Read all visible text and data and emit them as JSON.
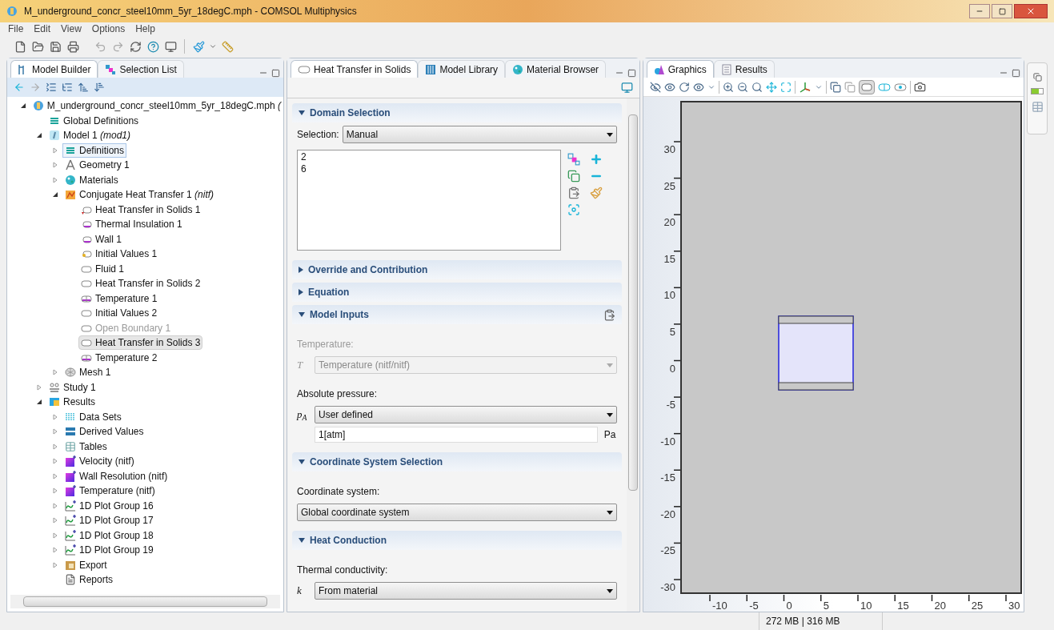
{
  "window": {
    "title": "M_underground_concr_steel10mm_5yr_18degC.mph - COMSOL Multiphysics"
  },
  "menu": [
    "File",
    "Edit",
    "View",
    "Options",
    "Help"
  ],
  "model_tree": {
    "tabs": [
      {
        "label": "Model Builder",
        "kind": "builder",
        "selected": true
      },
      {
        "label": "Selection List",
        "kind": "selection",
        "selected": false
      }
    ],
    "items": [
      {
        "label": "M_underground_concr_steel10mm_5yr_18degC.mph *(*",
        "kind": "file",
        "expanded": true,
        "selected": false,
        "focused": false,
        "disabled": false,
        "children": [
          {
            "label": "Global Definitions",
            "kind": "definitions",
            "selected": false,
            "focused": false,
            "disabled": false
          },
          {
            "label": "Model 1 *(mod1)*",
            "kind": "model",
            "expanded": true,
            "selected": false,
            "focused": false,
            "disabled": false,
            "children": [
              {
                "label": "Definitions",
                "kind": "definitions",
                "expanded": false,
                "selected": false,
                "focused": true,
                "disabled": false
              },
              {
                "label": "Geometry 1",
                "kind": "geometry",
                "expanded": false,
                "selected": false,
                "focused": false,
                "disabled": false
              },
              {
                "label": "Materials",
                "kind": "materials",
                "expanded": false,
                "selected": false,
                "focused": false,
                "disabled": false
              },
              {
                "label": "Conjugate Heat Transfer 1 *(nitf)*",
                "kind": "physics",
                "expanded": true,
                "selected": false,
                "focused": false,
                "disabled": false,
                "children": [
                  {
                    "label": "Heat Transfer in Solids 1",
                    "kind": "default-domain",
                    "selected": false,
                    "focused": false,
                    "disabled": false
                  },
                  {
                    "label": "Thermal Insulation 1",
                    "kind": "default-boundary",
                    "selected": false,
                    "focused": false,
                    "disabled": false
                  },
                  {
                    "label": "Wall 1",
                    "kind": "default-boundary",
                    "selected": false,
                    "focused": false,
                    "disabled": false
                  },
                  {
                    "label": "Initial Values 1",
                    "kind": "default-init",
                    "selected": false,
                    "focused": false,
                    "disabled": false
                  },
                  {
                    "label": "Fluid 1",
                    "kind": "domain",
                    "selected": false,
                    "focused": false,
                    "disabled": false
                  },
                  {
                    "label": "Heat Transfer in Solids 2",
                    "kind": "domain",
                    "selected": false,
                    "focused": false,
                    "disabled": false
                  },
                  {
                    "label": "Temperature 1",
                    "kind": "boundary",
                    "selected": false,
                    "focused": false,
                    "disabled": false
                  },
                  {
                    "label": "Initial Values 2",
                    "kind": "domain",
                    "selected": false,
                    "focused": false,
                    "disabled": false
                  },
                  {
                    "label": "Open Boundary 1",
                    "kind": "domain",
                    "selected": false,
                    "focused": false,
                    "disabled": true
                  },
                  {
                    "label": "Heat Transfer in Solids 3",
                    "kind": "domain",
                    "selected": true,
                    "focused": false,
                    "disabled": false
                  },
                  {
                    "label": "Temperature 2",
                    "kind": "boundary",
                    "selected": false,
                    "focused": false,
                    "disabled": false
                  }
                ]
              },
              {
                "label": "Mesh 1",
                "kind": "mesh",
                "expanded": false,
                "selected": false,
                "focused": false,
                "disabled": false
              }
            ]
          },
          {
            "label": "Study 1",
            "kind": "study",
            "expanded": false,
            "selected": false,
            "focused": false,
            "disabled": false
          },
          {
            "label": "Results",
            "kind": "results",
            "expanded": true,
            "selected": false,
            "focused": false,
            "disabled": false,
            "children": [
              {
                "label": "Data Sets",
                "kind": "datasets",
                "expanded": false,
                "selected": false,
                "focused": false,
                "disabled": false
              },
              {
                "label": "Derived Values",
                "kind": "derived",
                "expanded": false,
                "selected": false,
                "focused": false,
                "disabled": false
              },
              {
                "label": "Tables",
                "kind": "tables",
                "expanded": false,
                "selected": false,
                "focused": false,
                "disabled": false
              },
              {
                "label": "Velocity (nitf)",
                "kind": "plot2d",
                "expanded": false,
                "selected": false,
                "focused": false,
                "disabled": false
              },
              {
                "label": "Wall Resolution (nitf)",
                "kind": "plot2d",
                "expanded": false,
                "selected": false,
                "focused": false,
                "disabled": false
              },
              {
                "label": "Temperature (nitf)",
                "kind": "plot2d",
                "expanded": false,
                "selected": false,
                "focused": false,
                "disabled": false
              },
              {
                "label": "1D Plot Group 16",
                "kind": "plot1d",
                "expanded": false,
                "selected": false,
                "focused": false,
                "disabled": false
              },
              {
                "label": "1D Plot Group 17",
                "kind": "plot1d",
                "expanded": false,
                "selected": false,
                "focused": false,
                "disabled": false
              },
              {
                "label": "1D Plot Group 18",
                "kind": "plot1d",
                "expanded": false,
                "selected": false,
                "focused": false,
                "disabled": false
              },
              {
                "label": "1D Plot Group 19",
                "kind": "plot1d",
                "expanded": false,
                "selected": false,
                "focused": false,
                "disabled": false
              },
              {
                "label": "Export",
                "kind": "export",
                "expanded": false,
                "selected": false,
                "focused": false,
                "disabled": false
              },
              {
                "label": "Reports",
                "kind": "reports",
                "selected": false,
                "focused": false,
                "disabled": false
              }
            ]
          }
        ]
      }
    ]
  },
  "settings": {
    "tabs": [
      {
        "label": "Heat Transfer in Solids",
        "kind": "feature",
        "selected": true
      },
      {
        "label": "Model Library",
        "kind": "library",
        "selected": false
      },
      {
        "label": "Material Browser",
        "kind": "materials",
        "selected": false
      }
    ],
    "sections": [
      {
        "title": "Domain Selection",
        "expanded": true,
        "fields": [
          {
            "kind": "select",
            "label": "Selection:",
            "value": "Manual",
            "disabled": false
          },
          {
            "kind": "list",
            "items": [
              "2",
              "6"
            ]
          }
        ]
      },
      {
        "title": "Override and Contribution",
        "expanded": false
      },
      {
        "title": "Equation",
        "expanded": false
      },
      {
        "title": "Model Inputs",
        "expanded": true,
        "fields": [
          {
            "kind": "caption",
            "text": "Temperature:",
            "disabled": true
          },
          {
            "kind": "select",
            "symbol": "T",
            "value": "Temperature (nitf/nitf)",
            "disabled": true
          },
          {
            "kind": "caption",
            "text": "Absolute pressure:",
            "disabled": false
          },
          {
            "kind": "select",
            "symbol": "p$_{A}$",
            "value": "User defined",
            "disabled": false
          },
          {
            "kind": "input",
            "value": "1[atm]",
            "unit": "Pa"
          }
        ]
      },
      {
        "title": "Coordinate System Selection",
        "expanded": true,
        "fields": [
          {
            "kind": "caption",
            "text": "Coordinate system:",
            "disabled": false
          },
          {
            "kind": "select",
            "value": "Global coordinate system",
            "disabled": false
          }
        ]
      },
      {
        "title": "Heat Conduction",
        "expanded": true,
        "fields": [
          {
            "kind": "caption",
            "text": "Thermal conductivity:",
            "disabled": false
          },
          {
            "kind": "select",
            "symbol": "k",
            "value": "From material",
            "disabled": false
          }
        ]
      }
    ]
  },
  "graphics": {
    "tabs": [
      {
        "label": "Graphics",
        "kind": "graphics",
        "selected": true
      },
      {
        "label": "Results",
        "kind": "results",
        "selected": false
      }
    ],
    "y_ticks": [
      "30",
      "25",
      "20",
      "15",
      "10",
      "5",
      "0",
      "-5",
      "-10",
      "-15",
      "-20",
      "-25",
      "-30"
    ],
    "x_ticks": [
      "-10",
      "-5",
      "0",
      "5",
      "10",
      "15",
      "20",
      "25",
      "30"
    ]
  },
  "status_bar": {
    "memory": "272 MB | 316 MB"
  }
}
